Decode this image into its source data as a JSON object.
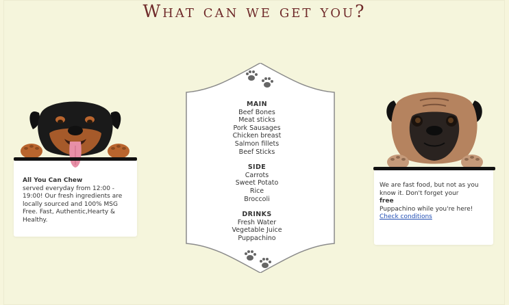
{
  "page": {
    "title": "What can we get you?"
  },
  "left_card": {
    "heading": "All You Can Chew",
    "body": "served everyday from 12:00 - 19:00! Our fresh ingredients are locally sourced and 100% MSG Free. Fast, Authentic,Hearty & Healthy."
  },
  "right_card": {
    "line1": "We are fast food, but not as you know it. Don't forget your",
    "free": "free",
    "line2": "Puppachino while you're here!",
    "link": "Check conditions"
  },
  "menu": {
    "main": {
      "title": "MAIN",
      "items": [
        "Beef Bones",
        "Meat sticks",
        "Pork Sausages",
        "Chicken breast",
        "Salmon fillets",
        "Beef Sticks"
      ]
    },
    "side": {
      "title": "SIDE",
      "items": [
        "Carrots",
        "Sweet Potato",
        "Rice",
        "Broccoli"
      ]
    },
    "drinks": {
      "title": "DRINKS",
      "items": [
        "Fresh Water",
        "Vegetable Juice",
        "Puppachino"
      ]
    }
  },
  "icons": {
    "paw_top": "paw-prints-icon",
    "paw_bottom": "paw-prints-icon",
    "left_dog": "rottweiler-illustration",
    "right_dog": "pug-illustration"
  },
  "colors": {
    "background": "#f5f5dc",
    "title": "#6f2a2a",
    "link": "#1f4db3",
    "card": "#ffffff"
  }
}
